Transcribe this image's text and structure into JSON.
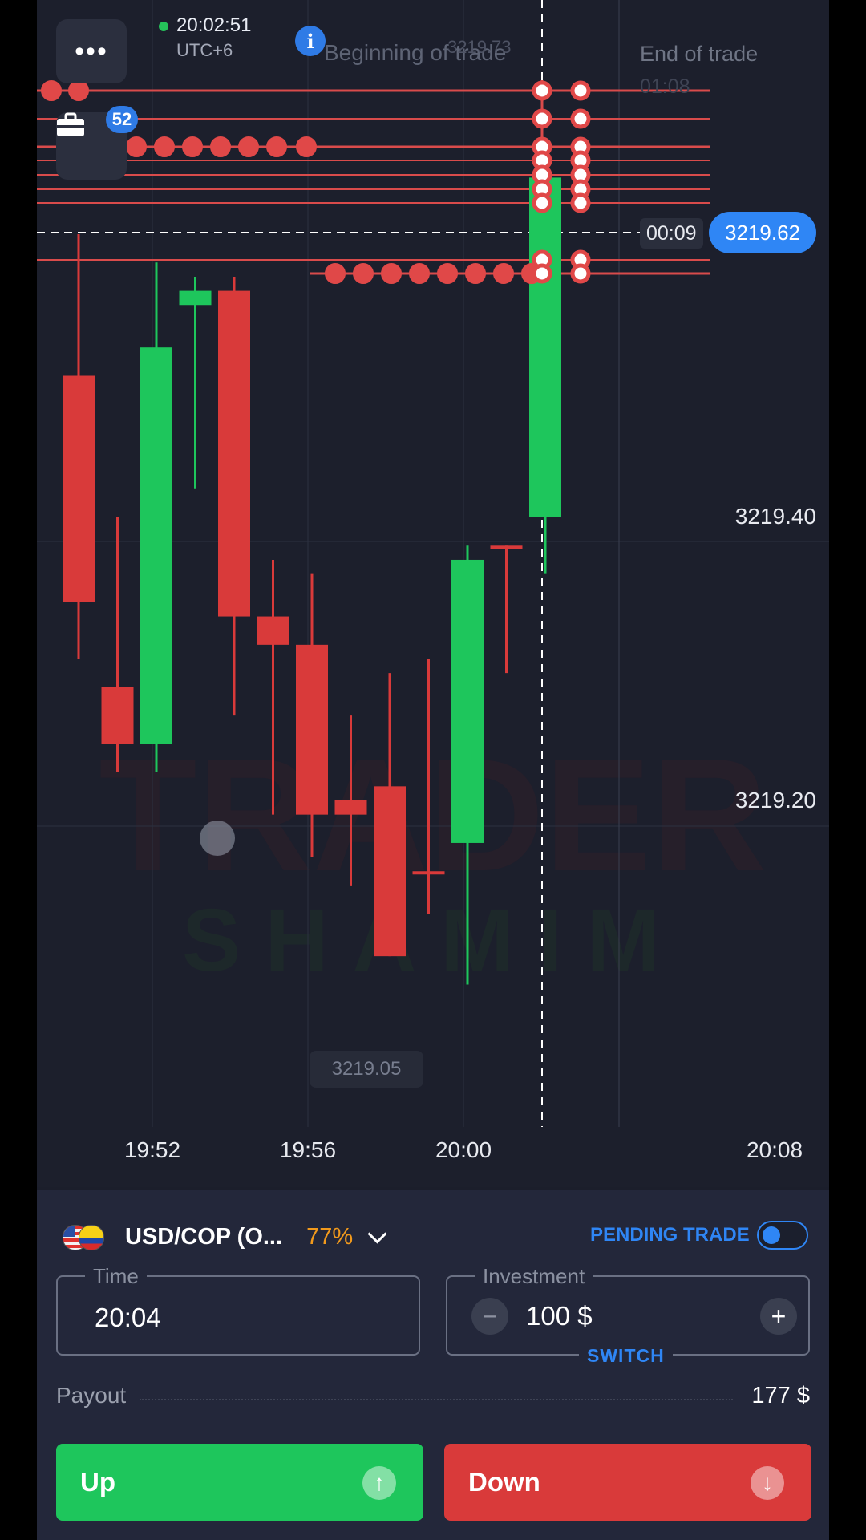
{
  "header": {
    "clock_time": "20:02:51",
    "timezone": "UTC+6",
    "menu_label": "•••",
    "trades_badge": "52",
    "beginning_label": "Beginning of trade",
    "ghost_price": "3219.73",
    "end_label": "End of trade",
    "end_timer": "01:08"
  },
  "chart": {
    "countdown": "00:09",
    "current_price": "3219.62",
    "price_labels": [
      "3219.40",
      "3219.20"
    ],
    "low_marker": "3219.05",
    "time_labels": [
      "19:52",
      "19:56",
      "20:00",
      "20:08"
    ]
  },
  "chart_data": {
    "type": "candlestick",
    "y_axis_ticks": [
      3219.4,
      3219.2
    ],
    "x_axis_ticks": [
      "19:52",
      "19:56",
      "20:00",
      "20:08"
    ],
    "current_price": 3219.62,
    "candles": [
      {
        "direction": "down",
        "open": 3219.5,
        "close": 3219.34,
        "high": 3219.6,
        "low": 3219.3
      },
      {
        "direction": "down",
        "open": 3219.28,
        "close": 3219.24,
        "high": 3219.4,
        "low": 3219.22
      },
      {
        "direction": "up",
        "open": 3219.24,
        "close": 3219.52,
        "high": 3219.58,
        "low": 3219.22
      },
      {
        "direction": "up",
        "open": 3219.55,
        "close": 3219.56,
        "high": 3219.57,
        "low": 3219.42
      },
      {
        "direction": "down",
        "open": 3219.56,
        "close": 3219.33,
        "high": 3219.57,
        "low": 3219.26
      },
      {
        "direction": "down",
        "open": 3219.33,
        "close": 3219.31,
        "high": 3219.37,
        "low": 3219.19
      },
      {
        "direction": "down",
        "open": 3219.31,
        "close": 3219.19,
        "high": 3219.36,
        "low": 3219.16
      },
      {
        "direction": "down",
        "open": 3219.2,
        "close": 3219.19,
        "high": 3219.26,
        "low": 3219.14
      },
      {
        "direction": "down",
        "open": 3219.21,
        "close": 3219.09,
        "high": 3219.29,
        "low": 3219.09
      },
      {
        "direction": "down",
        "open": 3219.15,
        "close": 3219.15,
        "high": 3219.3,
        "low": 3219.12
      },
      {
        "direction": "up",
        "open": 3219.17,
        "close": 3219.37,
        "high": 3219.38,
        "low": 3219.07
      },
      {
        "direction": "down",
        "open": 3219.38,
        "close": 3219.38,
        "high": 3219.38,
        "low": 3219.29
      },
      {
        "direction": "up",
        "open": 3219.4,
        "close": 3219.64,
        "high": 3219.64,
        "low": 3219.36
      }
    ]
  },
  "panel": {
    "asset_name": "USD/COP (O...",
    "asset_payout_pct": "77%",
    "pending_label": "PENDING TRADE",
    "time_label": "Time",
    "time_value": "20:04",
    "investment_label": "Investment",
    "investment_value": "100 $",
    "minus": "−",
    "plus": "+",
    "switch_label": "SWITCH",
    "payout_label": "Payout",
    "payout_value": "177 $",
    "up_label": "Up",
    "down_label": "Down",
    "up_icon": "↑",
    "down_icon": "↓"
  },
  "colors": {
    "up": "#1ec65c",
    "down": "#d93a3a",
    "accent": "#2f86f5",
    "orange": "#f29a1c"
  }
}
